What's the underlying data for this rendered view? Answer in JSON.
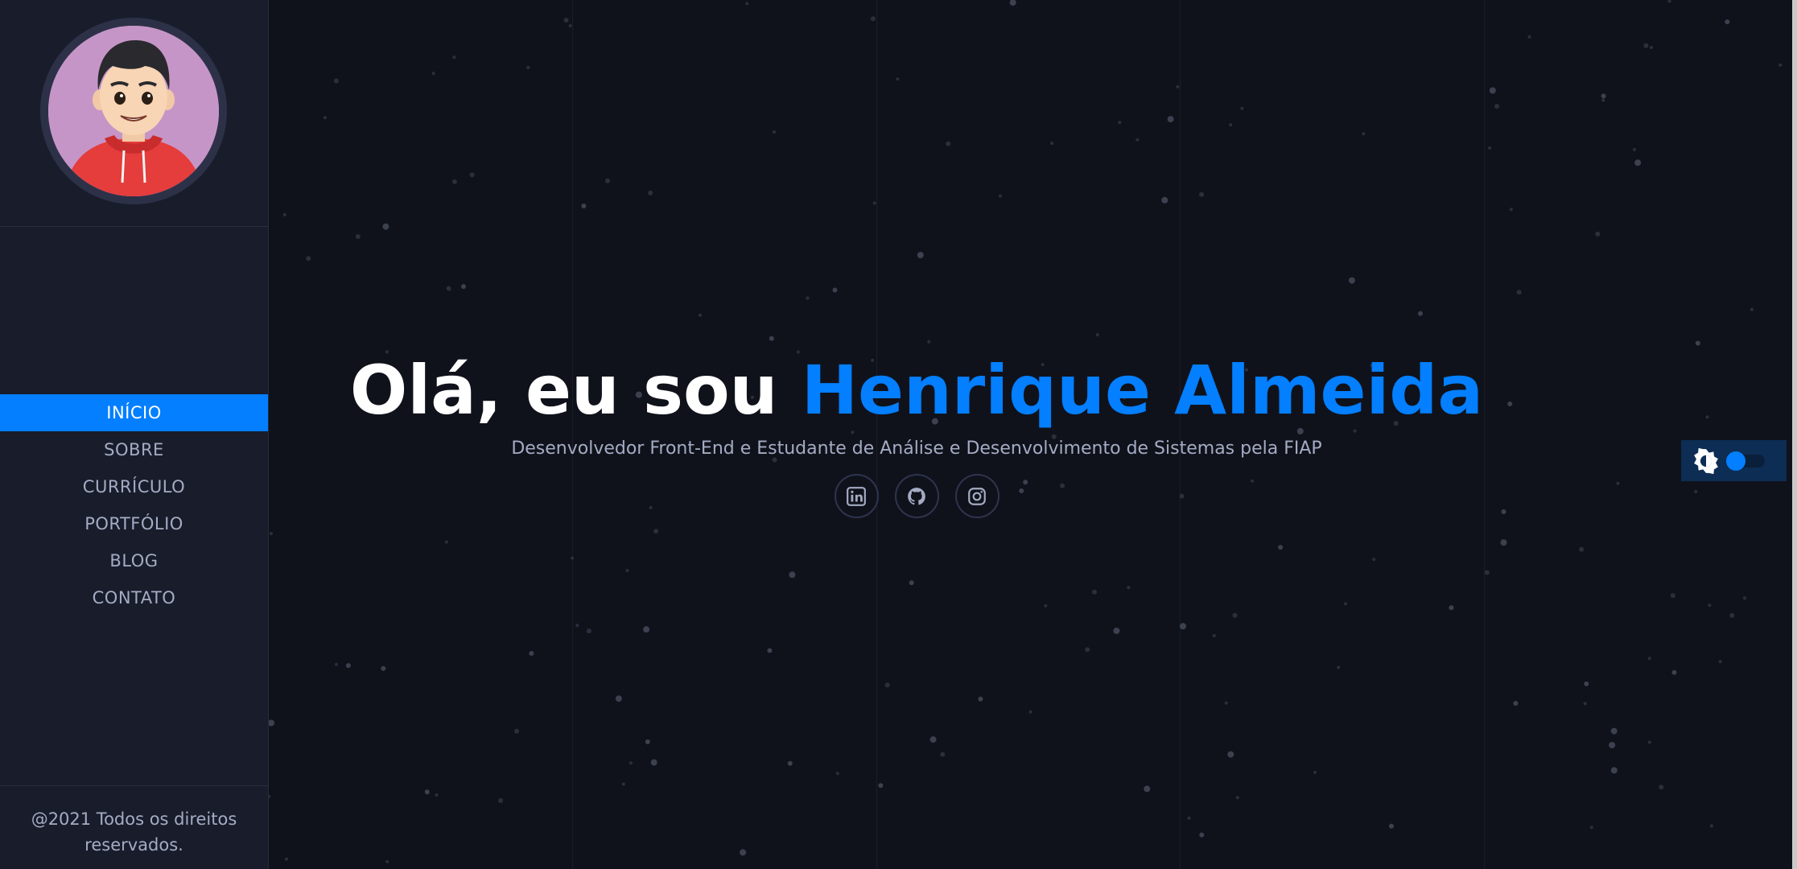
{
  "sidebar": {
    "nav": [
      {
        "label": "INÍCIO",
        "active": true
      },
      {
        "label": "SOBRE",
        "active": false
      },
      {
        "label": "CURRÍCULO",
        "active": false
      },
      {
        "label": "PORTFÓLIO",
        "active": false
      },
      {
        "label": "BLOG",
        "active": false
      },
      {
        "label": "CONTATO",
        "active": false
      }
    ],
    "copyright_line1": "@2021 Todos os direitos",
    "copyright_line2": "reservados."
  },
  "hero": {
    "greeting": "Olá, eu sou ",
    "name": "Henrique Almeida",
    "subtitle": "Desenvolvedor Front-End e Estudante de Análise e Desenvolvimento de Sistemas pela FIAP"
  },
  "social": [
    {
      "icon": "linkedin-icon"
    },
    {
      "icon": "github-icon"
    },
    {
      "icon": "instagram-icon"
    }
  ],
  "theme_toggle": {
    "icon": "brightness-icon",
    "dark_mode": true
  },
  "colors": {
    "accent": "#037fff",
    "sidebar_bg": "#191d2b",
    "main_bg": "#10121b",
    "text_muted": "#a4acc4"
  }
}
